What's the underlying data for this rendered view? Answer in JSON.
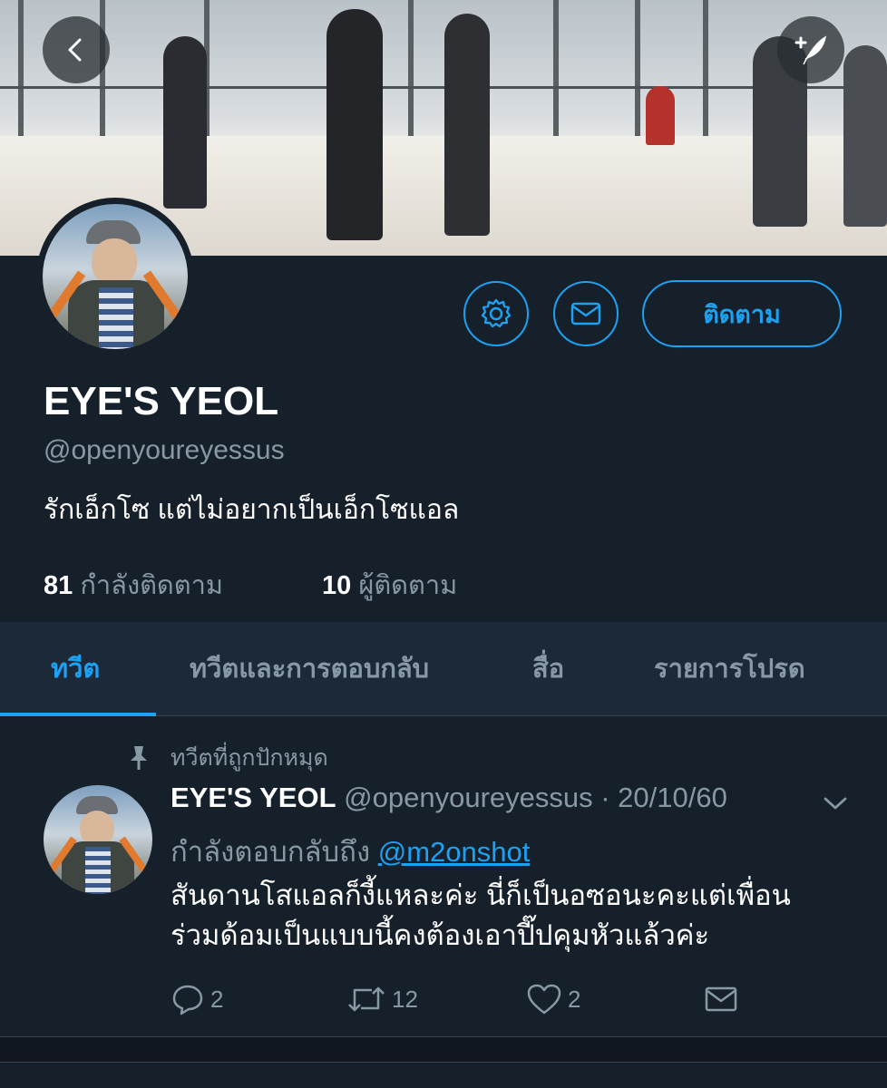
{
  "profile": {
    "display_name": "EYE'S YEOL",
    "handle": "@openyoureyessus",
    "bio": "รักเอ็กโซ แต่ไม่อยากเป็นเอ็กโซแอล",
    "following_count": "81",
    "following_label": "กำลังติดตาม",
    "followers_count": "10",
    "followers_label": "ผู้ติดตาม",
    "follow_button": "ติดตาม"
  },
  "tabs": [
    {
      "label": "ทวีต",
      "active": true
    },
    {
      "label": "ทวีตและการตอบกลับ",
      "active": false
    },
    {
      "label": "สื่อ",
      "active": false
    },
    {
      "label": "รายการโปรด",
      "active": false
    }
  ],
  "pinned_tweet": {
    "pinned_label": "ทวีตที่ถูกปักหมุด",
    "author_name": "EYE'S YEOL",
    "author_handle_date": "@openyoureyessus · 20/10/60",
    "reply_prefix": "กำลังตอบกลับถึง",
    "reply_to": "@m2onshot",
    "text_line1": "สันดานโสแอลก็งี้แหละค่ะ นี่ก็เป็นอซอนะคะแต่เพื่อน",
    "text_line2": "ร่วมด้อมเป็นแบบนี้คงต้องเอาปี๊ปคุมหัวแล้วค่ะ",
    "replies": "2",
    "retweets": "12",
    "likes": "2"
  },
  "icons": {
    "back": "back-arrow-icon",
    "compose": "compose-tweet-icon",
    "settings": "gear-icon",
    "message": "envelope-icon",
    "pin": "pin-icon",
    "chevron": "chevron-down-icon",
    "reply": "reply-icon",
    "retweet": "retweet-icon",
    "like": "heart-icon",
    "share": "envelope-icon"
  },
  "colors": {
    "background": "#15202b",
    "accent": "#1da1f2",
    "muted": "#8899a6",
    "tabs_bg": "#1c2938"
  }
}
